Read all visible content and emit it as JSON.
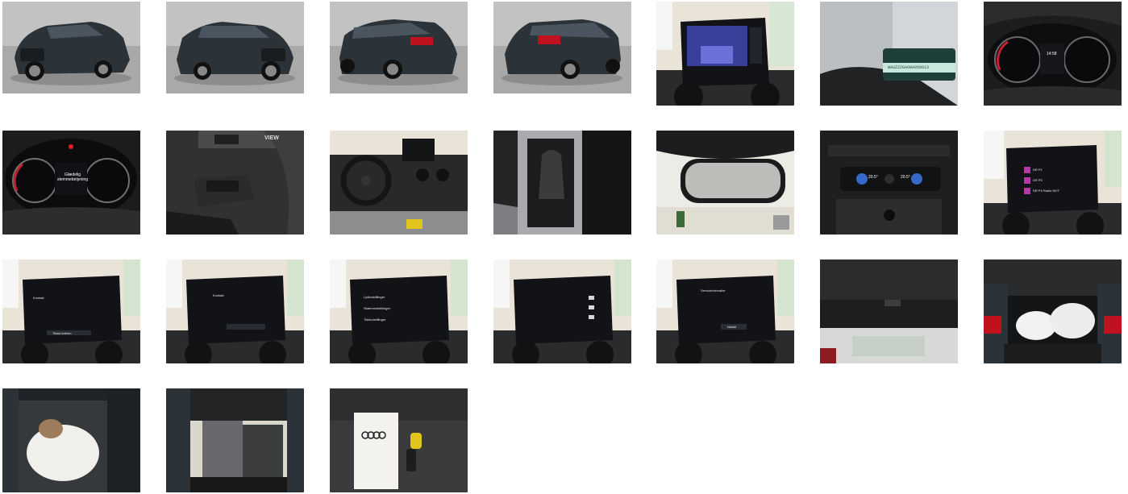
{
  "gallery": {
    "photos": [
      {
        "label": "front-left exterior"
      },
      {
        "label": "front-right exterior"
      },
      {
        "label": "rear-left exterior"
      },
      {
        "label": "rear-right exterior"
      },
      {
        "label": "rear camera screen"
      },
      {
        "label": "windshield badge"
      },
      {
        "label": "digital cockpit"
      },
      {
        "label": "instrument cluster"
      },
      {
        "label": "light switch"
      },
      {
        "label": "dashboard interior"
      },
      {
        "label": "gear selector"
      },
      {
        "label": "rearview mirror"
      },
      {
        "label": "climate control"
      },
      {
        "label": "radio screen"
      },
      {
        "label": "screen bluetooth"
      },
      {
        "label": "screen pairing"
      },
      {
        "label": "screen settings"
      },
      {
        "label": "screen assist"
      },
      {
        "label": "screen service"
      },
      {
        "label": "tailgate"
      },
      {
        "label": "luggage compartment"
      },
      {
        "label": "rear seat"
      },
      {
        "label": "front seat"
      },
      {
        "label": "manual and keys"
      }
    ]
  },
  "texts": {
    "badge": "WAUZZZGA6NA050813",
    "dial_title": "Glædelig\nstemmebetjening",
    "dial_sub": "Fold af",
    "view_label": "VIEW",
    "climate_left": "20.5°",
    "climate_right": "20.5°",
    "cockpit_time": "14:58",
    "radio_rows": [
      "DR P1",
      "DR P3",
      "DR P4 Radio NOT",
      "DR P4 Ny Nordjyll"
    ],
    "screen_kontakt": "Kontakt",
    "screen_tilslut": "Tilslut telefon",
    "screen_settings_rows": [
      "Lydindstillinger",
      "Skærmindstillinger",
      "Tidsindstillinger"
    ],
    "screen_service_title": "Serviceintervaller",
    "screen_service_btn": "Nulstil"
  },
  "colors": {
    "studio_bg": "#b9b9b9",
    "car_body": "#2c3338",
    "taillight": "#c0111f",
    "screen_blue": "#3a3f9a",
    "showroom_wall": "#e9e4d7",
    "dash_dark": "#1f2124"
  }
}
